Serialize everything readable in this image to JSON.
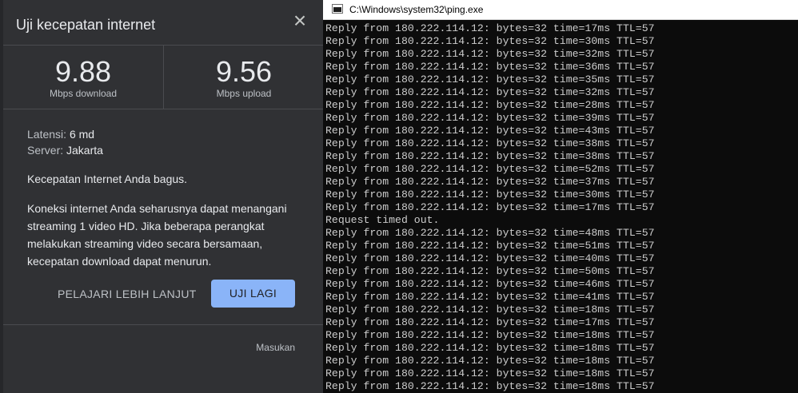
{
  "speed_test": {
    "title": "Uji kecepatan internet",
    "close_label": "×",
    "download": {
      "value": "9.88",
      "unit": "Mbps download"
    },
    "upload": {
      "value": "9.56",
      "unit": "Mbps upload"
    },
    "latency_label": "Latensi:",
    "latency_value": "6 md",
    "server_label": "Server:",
    "server_value": "Jakarta",
    "verdict": "Kecepatan Internet Anda bagus.",
    "explanation": "Koneksi internet Anda seharusnya dapat menangani streaming 1 video HD. Jika beberapa perangkat melakukan streaming video secara bersamaan, kecepatan download dapat menurun.",
    "learn_more_label": "PELAJARI LEBIH LANJUT",
    "retry_label": "UJI LAGI",
    "feedback_label": "Masukan"
  },
  "console": {
    "window_title": "C:\\Windows\\system32\\ping.exe",
    "lines": [
      "Reply from 180.222.114.12: bytes=32 time=17ms TTL=57",
      "Reply from 180.222.114.12: bytes=32 time=30ms TTL=57",
      "Reply from 180.222.114.12: bytes=32 time=32ms TTL=57",
      "Reply from 180.222.114.12: bytes=32 time=36ms TTL=57",
      "Reply from 180.222.114.12: bytes=32 time=35ms TTL=57",
      "Reply from 180.222.114.12: bytes=32 time=32ms TTL=57",
      "Reply from 180.222.114.12: bytes=32 time=28ms TTL=57",
      "Reply from 180.222.114.12: bytes=32 time=39ms TTL=57",
      "Reply from 180.222.114.12: bytes=32 time=43ms TTL=57",
      "Reply from 180.222.114.12: bytes=32 time=38ms TTL=57",
      "Reply from 180.222.114.12: bytes=32 time=38ms TTL=57",
      "Reply from 180.222.114.12: bytes=32 time=52ms TTL=57",
      "Reply from 180.222.114.12: bytes=32 time=37ms TTL=57",
      "Reply from 180.222.114.12: bytes=32 time=30ms TTL=57",
      "Reply from 180.222.114.12: bytes=32 time=17ms TTL=57",
      "Request timed out.",
      "Reply from 180.222.114.12: bytes=32 time=48ms TTL=57",
      "Reply from 180.222.114.12: bytes=32 time=51ms TTL=57",
      "Reply from 180.222.114.12: bytes=32 time=40ms TTL=57",
      "Reply from 180.222.114.12: bytes=32 time=50ms TTL=57",
      "Reply from 180.222.114.12: bytes=32 time=46ms TTL=57",
      "Reply from 180.222.114.12: bytes=32 time=41ms TTL=57",
      "Reply from 180.222.114.12: bytes=32 time=18ms TTL=57",
      "Reply from 180.222.114.12: bytes=32 time=17ms TTL=57",
      "Reply from 180.222.114.12: bytes=32 time=18ms TTL=57",
      "Reply from 180.222.114.12: bytes=32 time=18ms TTL=57",
      "Reply from 180.222.114.12: bytes=32 time=18ms TTL=57",
      "Reply from 180.222.114.12: bytes=32 time=18ms TTL=57",
      "Reply from 180.222.114.12: bytes=32 time=18ms TTL=57"
    ]
  },
  "colors": {
    "card_background": "#303134",
    "retry_button": "#8ab4f8",
    "console_background": "#0c0c0c",
    "console_text": "#cccccc"
  }
}
